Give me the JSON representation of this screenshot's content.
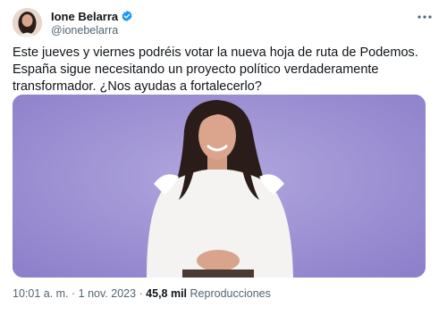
{
  "author": {
    "display_name": "Ione Belarra",
    "handle": "@ionebelarra",
    "avatar_icon": "profile-photo",
    "verified_icon": "verified-badge-icon",
    "verified_color": "#1d9bf0"
  },
  "more_icon": "more-dots-icon",
  "tweet": {
    "lines": [
      "Este jueves y viernes podréis votar la nueva hoja de ruta de Podemos.",
      "España sigue necesitando un proyecto político verdaderamente",
      "transformador. ¿Nos ayudas a fortalecerlo?"
    ]
  },
  "media": {
    "kind": "video-still",
    "background_color": "#9c8fd3"
  },
  "meta": {
    "time": "10:01 a. m.",
    "separator": " · ",
    "date": "1 nov. 2023",
    "separator2": " · ",
    "views_count": "45,8 mil",
    "views_label": " Reproducciones"
  }
}
